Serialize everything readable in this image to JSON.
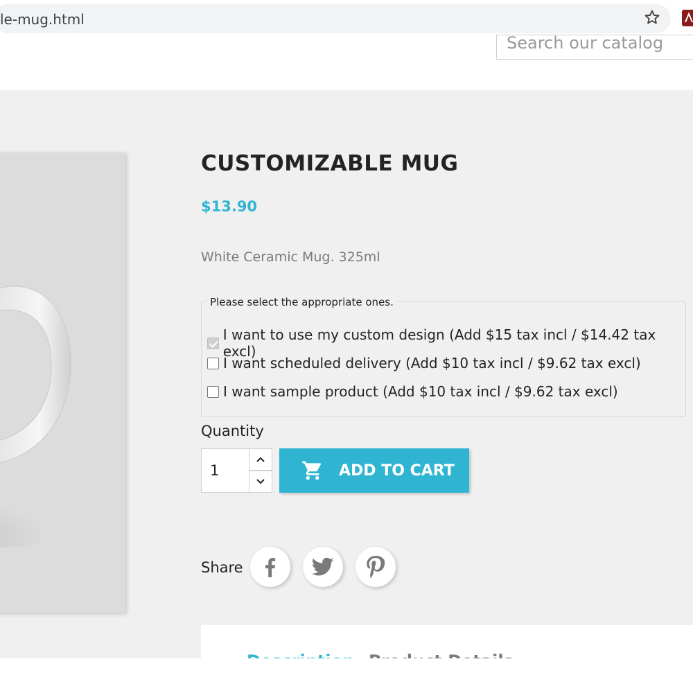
{
  "browser": {
    "url": "le-mug.html"
  },
  "header": {
    "search_placeholder": "Search our catalog"
  },
  "product": {
    "title": "CUSTOMIZABLE MUG",
    "price": "$13.90",
    "description": "White Ceramic Mug. 325ml",
    "options_legend": "Please select the appropriate ones.",
    "options": [
      {
        "label": "I want to use my custom design (Add $15 tax incl / $14.42 tax excl)",
        "checked": true
      },
      {
        "label": "I want scheduled delivery (Add $10 tax incl / $9.62 tax excl)",
        "checked": false
      },
      {
        "label": "I want sample product (Add $10 tax incl / $9.62 tax excl)",
        "checked": false
      }
    ],
    "quantity_label": "Quantity",
    "quantity_value": "1",
    "add_to_cart_label": "ADD TO CART",
    "share_label": "Share"
  },
  "tabs": [
    {
      "label": "Description"
    },
    {
      "label": "Product Details"
    }
  ],
  "colors": {
    "accent": "#2fb5d2",
    "background": "#f0f0f0",
    "text": "#232323"
  }
}
